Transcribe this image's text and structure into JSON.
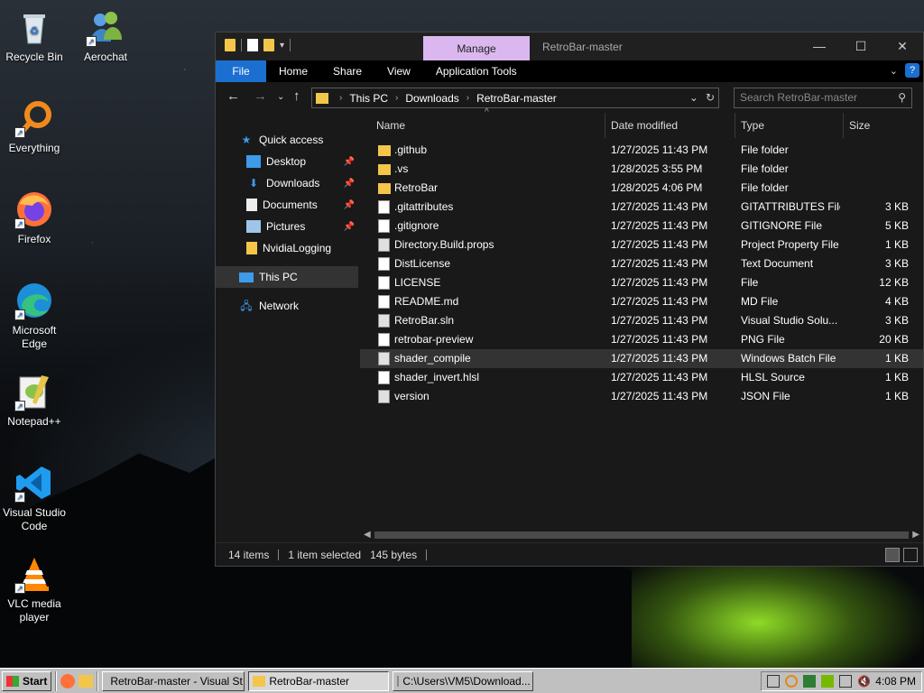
{
  "desktop": {
    "icons": [
      {
        "label": "Recycle Bin",
        "icon": "recycle-bin-icon"
      },
      {
        "label": "Aerochat",
        "icon": "aerochat-icon"
      },
      {
        "label": "Everything",
        "icon": "everything-icon"
      },
      {
        "label": "Firefox",
        "icon": "firefox-icon"
      },
      {
        "label": "Microsoft Edge",
        "icon": "edge-icon"
      },
      {
        "label": "Notepad++",
        "icon": "notepadpp-icon"
      },
      {
        "label": "Visual Studio Code",
        "icon": "vscode-icon"
      },
      {
        "label": "VLC media player",
        "icon": "vlc-icon"
      }
    ]
  },
  "explorer": {
    "manage_tab": "Manage",
    "title": "RetroBar-master",
    "controls": {
      "minimize": "—",
      "maximize": "☐",
      "close": "✕"
    },
    "ribbon_tabs": [
      "File",
      "Home",
      "Share",
      "View",
      "Application Tools"
    ],
    "breadcrumb": [
      "This PC",
      "Downloads",
      "RetroBar-master"
    ],
    "search_placeholder": "Search RetroBar-master",
    "nav": {
      "quick_access": "Quick access",
      "items": [
        {
          "label": "Desktop",
          "pinned": true
        },
        {
          "label": "Downloads",
          "pinned": true
        },
        {
          "label": "Documents",
          "pinned": true
        },
        {
          "label": "Pictures",
          "pinned": true
        },
        {
          "label": "NvidiaLogging",
          "pinned": false
        }
      ],
      "this_pc": "This PC",
      "network": "Network"
    },
    "columns": {
      "name": "Name",
      "date": "Date modified",
      "type": "Type",
      "size": "Size"
    },
    "files": [
      {
        "name": ".github",
        "date": "1/27/2025 11:43 PM",
        "type": "File folder",
        "size": "",
        "kind": "folder"
      },
      {
        "name": ".vs",
        "date": "1/28/2025 3:55 PM",
        "type": "File folder",
        "size": "",
        "kind": "folder"
      },
      {
        "name": "RetroBar",
        "date": "1/28/2025 4:06 PM",
        "type": "File folder",
        "size": "",
        "kind": "folder"
      },
      {
        "name": ".gitattributes",
        "date": "1/27/2025 11:43 PM",
        "type": "GITATTRIBUTES File",
        "size": "3 KB",
        "kind": "doc"
      },
      {
        "name": ".gitignore",
        "date": "1/27/2025 11:43 PM",
        "type": "GITIGNORE File",
        "size": "5 KB",
        "kind": "doc"
      },
      {
        "name": "Directory.Build.props",
        "date": "1/27/2025 11:43 PM",
        "type": "Project Property File",
        "size": "1 KB",
        "kind": "sys"
      },
      {
        "name": "DistLicense",
        "date": "1/27/2025 11:43 PM",
        "type": "Text Document",
        "size": "3 KB",
        "kind": "doc"
      },
      {
        "name": "LICENSE",
        "date": "1/27/2025 11:43 PM",
        "type": "File",
        "size": "12 KB",
        "kind": "doc"
      },
      {
        "name": "README.md",
        "date": "1/27/2025 11:43 PM",
        "type": "MD File",
        "size": "4 KB",
        "kind": "doc"
      },
      {
        "name": "RetroBar.sln",
        "date": "1/27/2025 11:43 PM",
        "type": "Visual Studio Solu...",
        "size": "3 KB",
        "kind": "sys"
      },
      {
        "name": "retrobar-preview",
        "date": "1/27/2025 11:43 PM",
        "type": "PNG File",
        "size": "20 KB",
        "kind": "doc"
      },
      {
        "name": "shader_compile",
        "date": "1/27/2025 11:43 PM",
        "type": "Windows Batch File",
        "size": "1 KB",
        "kind": "sys",
        "selected": true
      },
      {
        "name": "shader_invert.hlsl",
        "date": "1/27/2025 11:43 PM",
        "type": "HLSL Source",
        "size": "1 KB",
        "kind": "doc"
      },
      {
        "name": "version",
        "date": "1/27/2025 11:43 PM",
        "type": "JSON File",
        "size": "1 KB",
        "kind": "sys"
      }
    ],
    "status": {
      "count": "14 items",
      "selected": "1 item selected",
      "size": "145 bytes"
    }
  },
  "taskbar": {
    "start": "Start",
    "tasks": [
      {
        "label": "RetroBar-master - Visual St...",
        "pressed": false
      },
      {
        "label": "RetroBar-master",
        "pressed": true
      },
      {
        "label": "C:\\Users\\VM5\\Download...",
        "pressed": false
      }
    ],
    "clock": "4:08 PM"
  }
}
